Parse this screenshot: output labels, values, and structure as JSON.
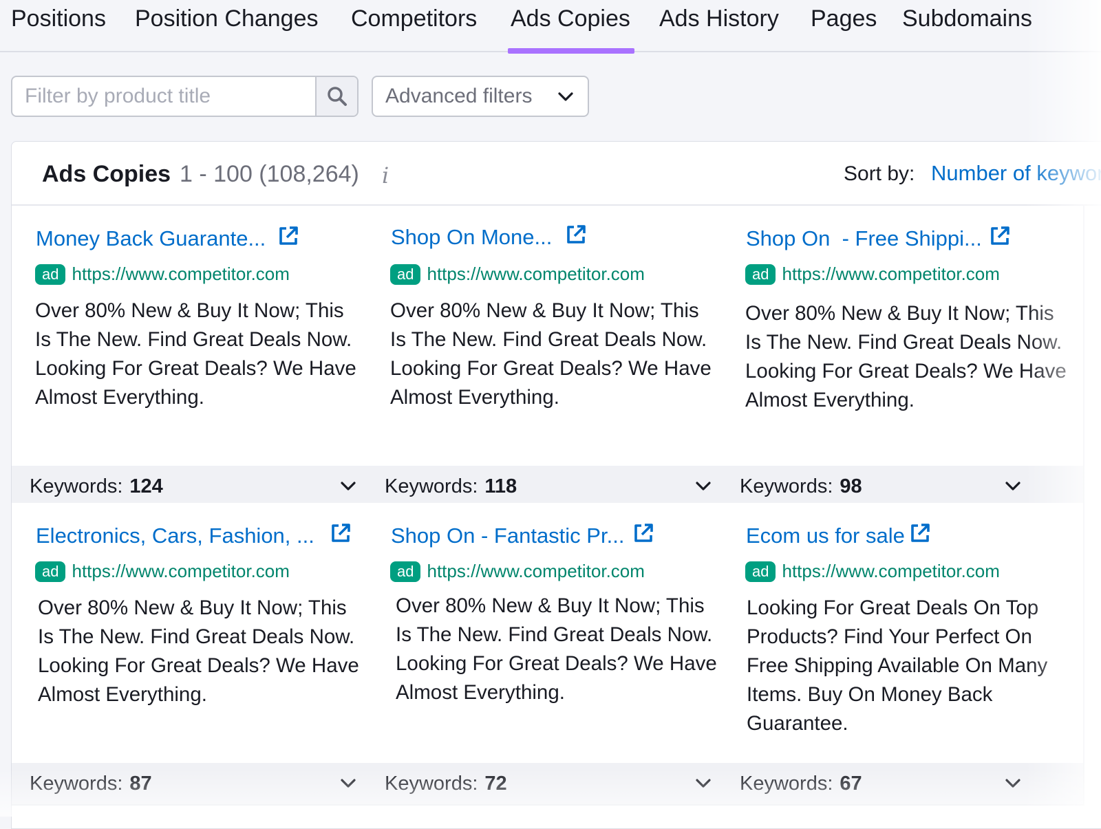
{
  "tabs": [
    {
      "label": "Positions",
      "active": false
    },
    {
      "label": "Position Changes",
      "active": false
    },
    {
      "label": "Competitors",
      "active": false
    },
    {
      "label": "Ads Copies",
      "active": true
    },
    {
      "label": "Ads History",
      "active": false
    },
    {
      "label": "Pages",
      "active": false
    },
    {
      "label": "Subdomains",
      "active": false
    }
  ],
  "filter": {
    "placeholder": "Filter by product title",
    "search_icon": "search-icon",
    "advanced_label": "Advanced filters",
    "advanced_icon": "chevron-down-icon"
  },
  "panel": {
    "title": "Ads Copies",
    "range": "1 - 100 (108,264)",
    "info_icon": "i",
    "sort_label": "Sort by:",
    "sort_value": "Number of keywords"
  },
  "cards": [
    {
      "title": "Money Back Guarante...",
      "badge": "ad",
      "url": "https://www.competitor.com",
      "description": "Over 80% New & Buy It Now; This Is The New. Find Great Deals Now. Looking For Great Deals? We Have Almost Everything.",
      "keywords_label": "Keywords:",
      "keywords": "124"
    },
    {
      "title": "Shop On Mone...",
      "badge": "ad",
      "url": "https://www.competitor.com",
      "description": "Over 80% New & Buy It Now; This Is The New. Find Great Deals Now. Looking For Great Deals? We Have Almost Everything.",
      "keywords_label": "Keywords:",
      "keywords": "118"
    },
    {
      "title": "Shop On  - Free Shippi...",
      "badge": "ad",
      "url": "https://www.competitor.com",
      "description": "Over 80% New & Buy It Now; This Is The New. Find Great Deals Now. Looking For Great Deals? We Have Almost Everything.",
      "keywords_label": "Keywords:",
      "keywords": "98"
    },
    {
      "title": "Electronics, Cars, Fashion, ...",
      "badge": "ad",
      "url": "https://www.competitor.com",
      "description": "Over 80% New & Buy It Now; This Is The New. Find Great Deals Now. Looking For Great Deals? We Have Almost Everything.",
      "keywords_label": "Keywords:",
      "keywords": "87"
    },
    {
      "title": "Shop On - Fantastic Pr...",
      "badge": "ad",
      "url": "https://www.competitor.com",
      "description": "Over 80% New & Buy It Now; This Is The New. Find Great Deals Now. Looking For Great Deals? We Have Almost Everything.",
      "keywords_label": "Keywords:",
      "keywords": "72"
    },
    {
      "title": "Ecom us for sale",
      "badge": "ad",
      "url": "https://www.competitor.com",
      "description": "Looking For Great Deals On Top Products? Find Your Perfect On Free Shipping Available On Many Items. Buy On Money Back Guarantee.",
      "keywords_label": "Keywords:",
      "keywords": "67"
    }
  ],
  "colors": {
    "accent_tab": "#a972ff",
    "link": "#006dca",
    "ad_badge": "#009f81",
    "ad_url": "#00856c"
  }
}
